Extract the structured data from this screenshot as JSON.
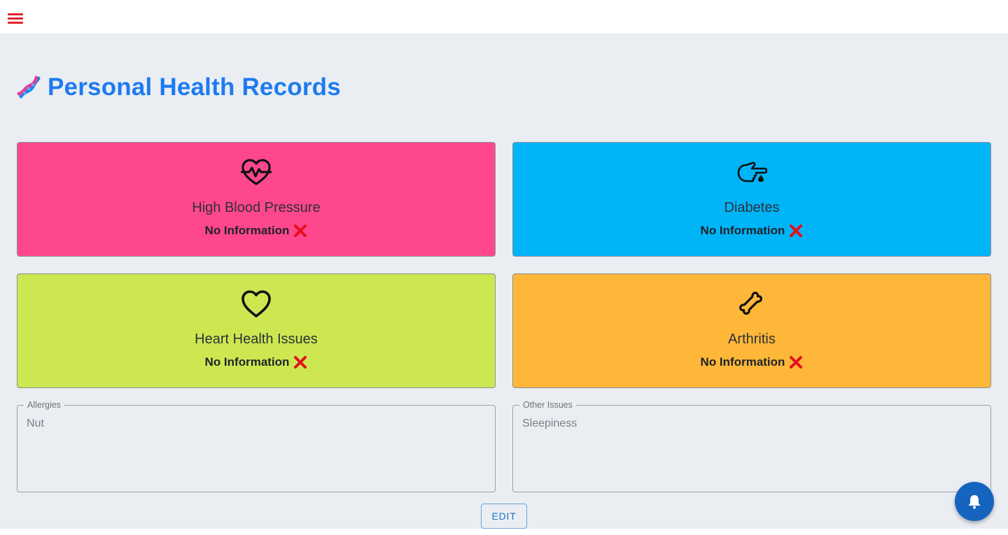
{
  "header": {
    "menu_icon": "hamburger-menu-icon"
  },
  "page": {
    "title": "Personal Health Records",
    "title_icon": "dna-icon",
    "title_color": "#1e7bf0"
  },
  "cards": [
    {
      "label": "High Blood Pressure",
      "status": "No Information",
      "icon": "heart-pulse-icon",
      "color": "#ff4790"
    },
    {
      "label": "Diabetes",
      "status": "No Information",
      "icon": "hand-drop-icon",
      "color": "#00b4f8"
    },
    {
      "label": "Heart Health Issues",
      "status": "No Information",
      "icon": "heart-outline-icon",
      "color": "#cde751"
    },
    {
      "label": "Arthritis",
      "status": "No Information",
      "icon": "bone-icon",
      "color": "#ffb739"
    }
  ],
  "fields": {
    "allergies": {
      "label": "Allergies",
      "value": "Nut"
    },
    "other_issues": {
      "label": "Other Issues",
      "value": "Sleepiness"
    }
  },
  "actions": {
    "edit_label": "EDIT",
    "notification_icon": "bell-icon"
  },
  "colors": {
    "status_x": "#e3101c",
    "fab": "#1565c0",
    "menu": "#e3262b"
  }
}
